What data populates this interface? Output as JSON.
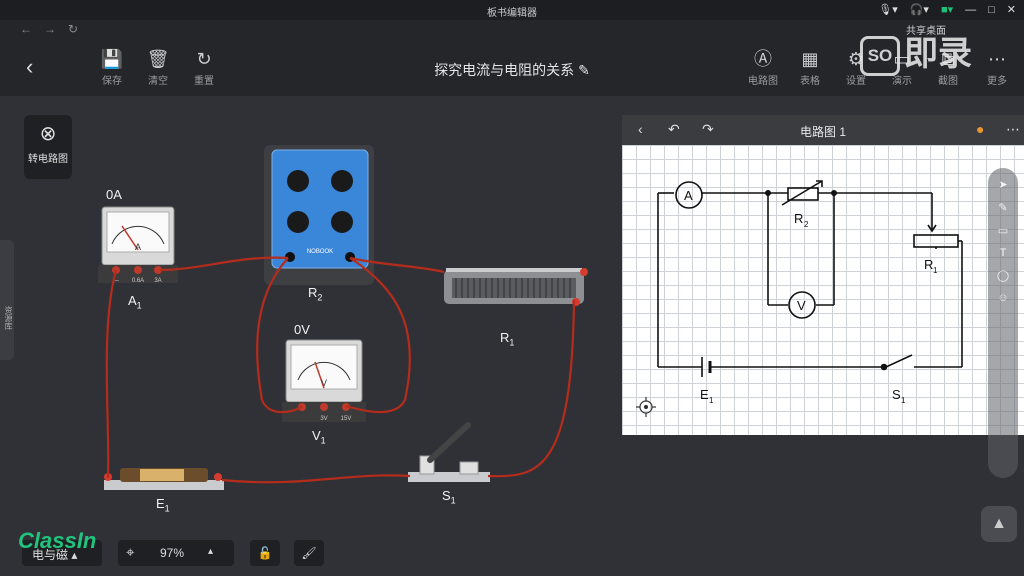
{
  "window": {
    "title": "板书编辑器"
  },
  "titlebar": {
    "mic": "🎙▾",
    "headset": "🎧▾",
    "camera": "■▾",
    "min": "—",
    "max": "□",
    "close": "✕"
  },
  "nav": {
    "back": "←",
    "forward": "→",
    "refresh": "↻"
  },
  "share_label": "共享桌面",
  "toolbar": {
    "back_icon": "‹",
    "save": {
      "icon": "💾",
      "label": "保存"
    },
    "clear": {
      "icon": "🗑",
      "label": "清空"
    },
    "reset": {
      "icon": "↻",
      "label": "重置"
    },
    "circuit_diagram": {
      "icon": "Ⓐ",
      "label": "电路图"
    },
    "table": {
      "icon": "▦",
      "label": "表格"
    },
    "settings": {
      "icon": "⚙",
      "label": "设置"
    },
    "demo": {
      "icon": "▭",
      "label": "演示"
    },
    "screenshot": {
      "icon": "⧉",
      "label": "截图"
    },
    "more": {
      "icon": "⋯",
      "label": "更多"
    }
  },
  "document": {
    "title": "探究电流与电阻的关系 ✎"
  },
  "watermark": {
    "badge": "SO",
    "text": "即录"
  },
  "left_panel": {
    "convert_icon": "⊗",
    "convert_label": "转电路图",
    "side_tab": "资源库"
  },
  "components": {
    "ammeter": {
      "reading": "0A",
      "name": "A",
      "sub": "1",
      "scale_left": "—",
      "scale_mid": "0.6A",
      "scale_right": "3A"
    },
    "resistance_box": {
      "name": "R",
      "sub": "2",
      "brand": "NOBOOK"
    },
    "voltmeter": {
      "reading": "0V",
      "name": "V",
      "sub": "1",
      "scale_mid": "3V",
      "scale_right": "15V"
    },
    "rheostat": {
      "name": "R",
      "sub": "1"
    },
    "battery": {
      "name": "E",
      "sub": "1"
    },
    "switch": {
      "name": "S",
      "sub": "1"
    }
  },
  "diagram_panel": {
    "back": "‹",
    "undo": "↶",
    "redo": "↷",
    "title": "电路图 1",
    "more": "⋯",
    "labels": {
      "ammeter": "A",
      "voltmeter": "V",
      "r2": "R",
      "r1": "R",
      "e1": "E",
      "s1": "S",
      "sub": "1",
      "sub2": "2"
    }
  },
  "bottom_bar": {
    "mode": "电与磁 ▴",
    "zoom": "97%",
    "zoom_arrow": "▴",
    "locate_icon": "⌖",
    "lock_icon": "🔓",
    "brush_icon": "🖌"
  },
  "brand": "ClassIn",
  "colors": {
    "wire": "#b52c1c",
    "accent": "#21c37d",
    "box_blue": "#3a86d8"
  }
}
